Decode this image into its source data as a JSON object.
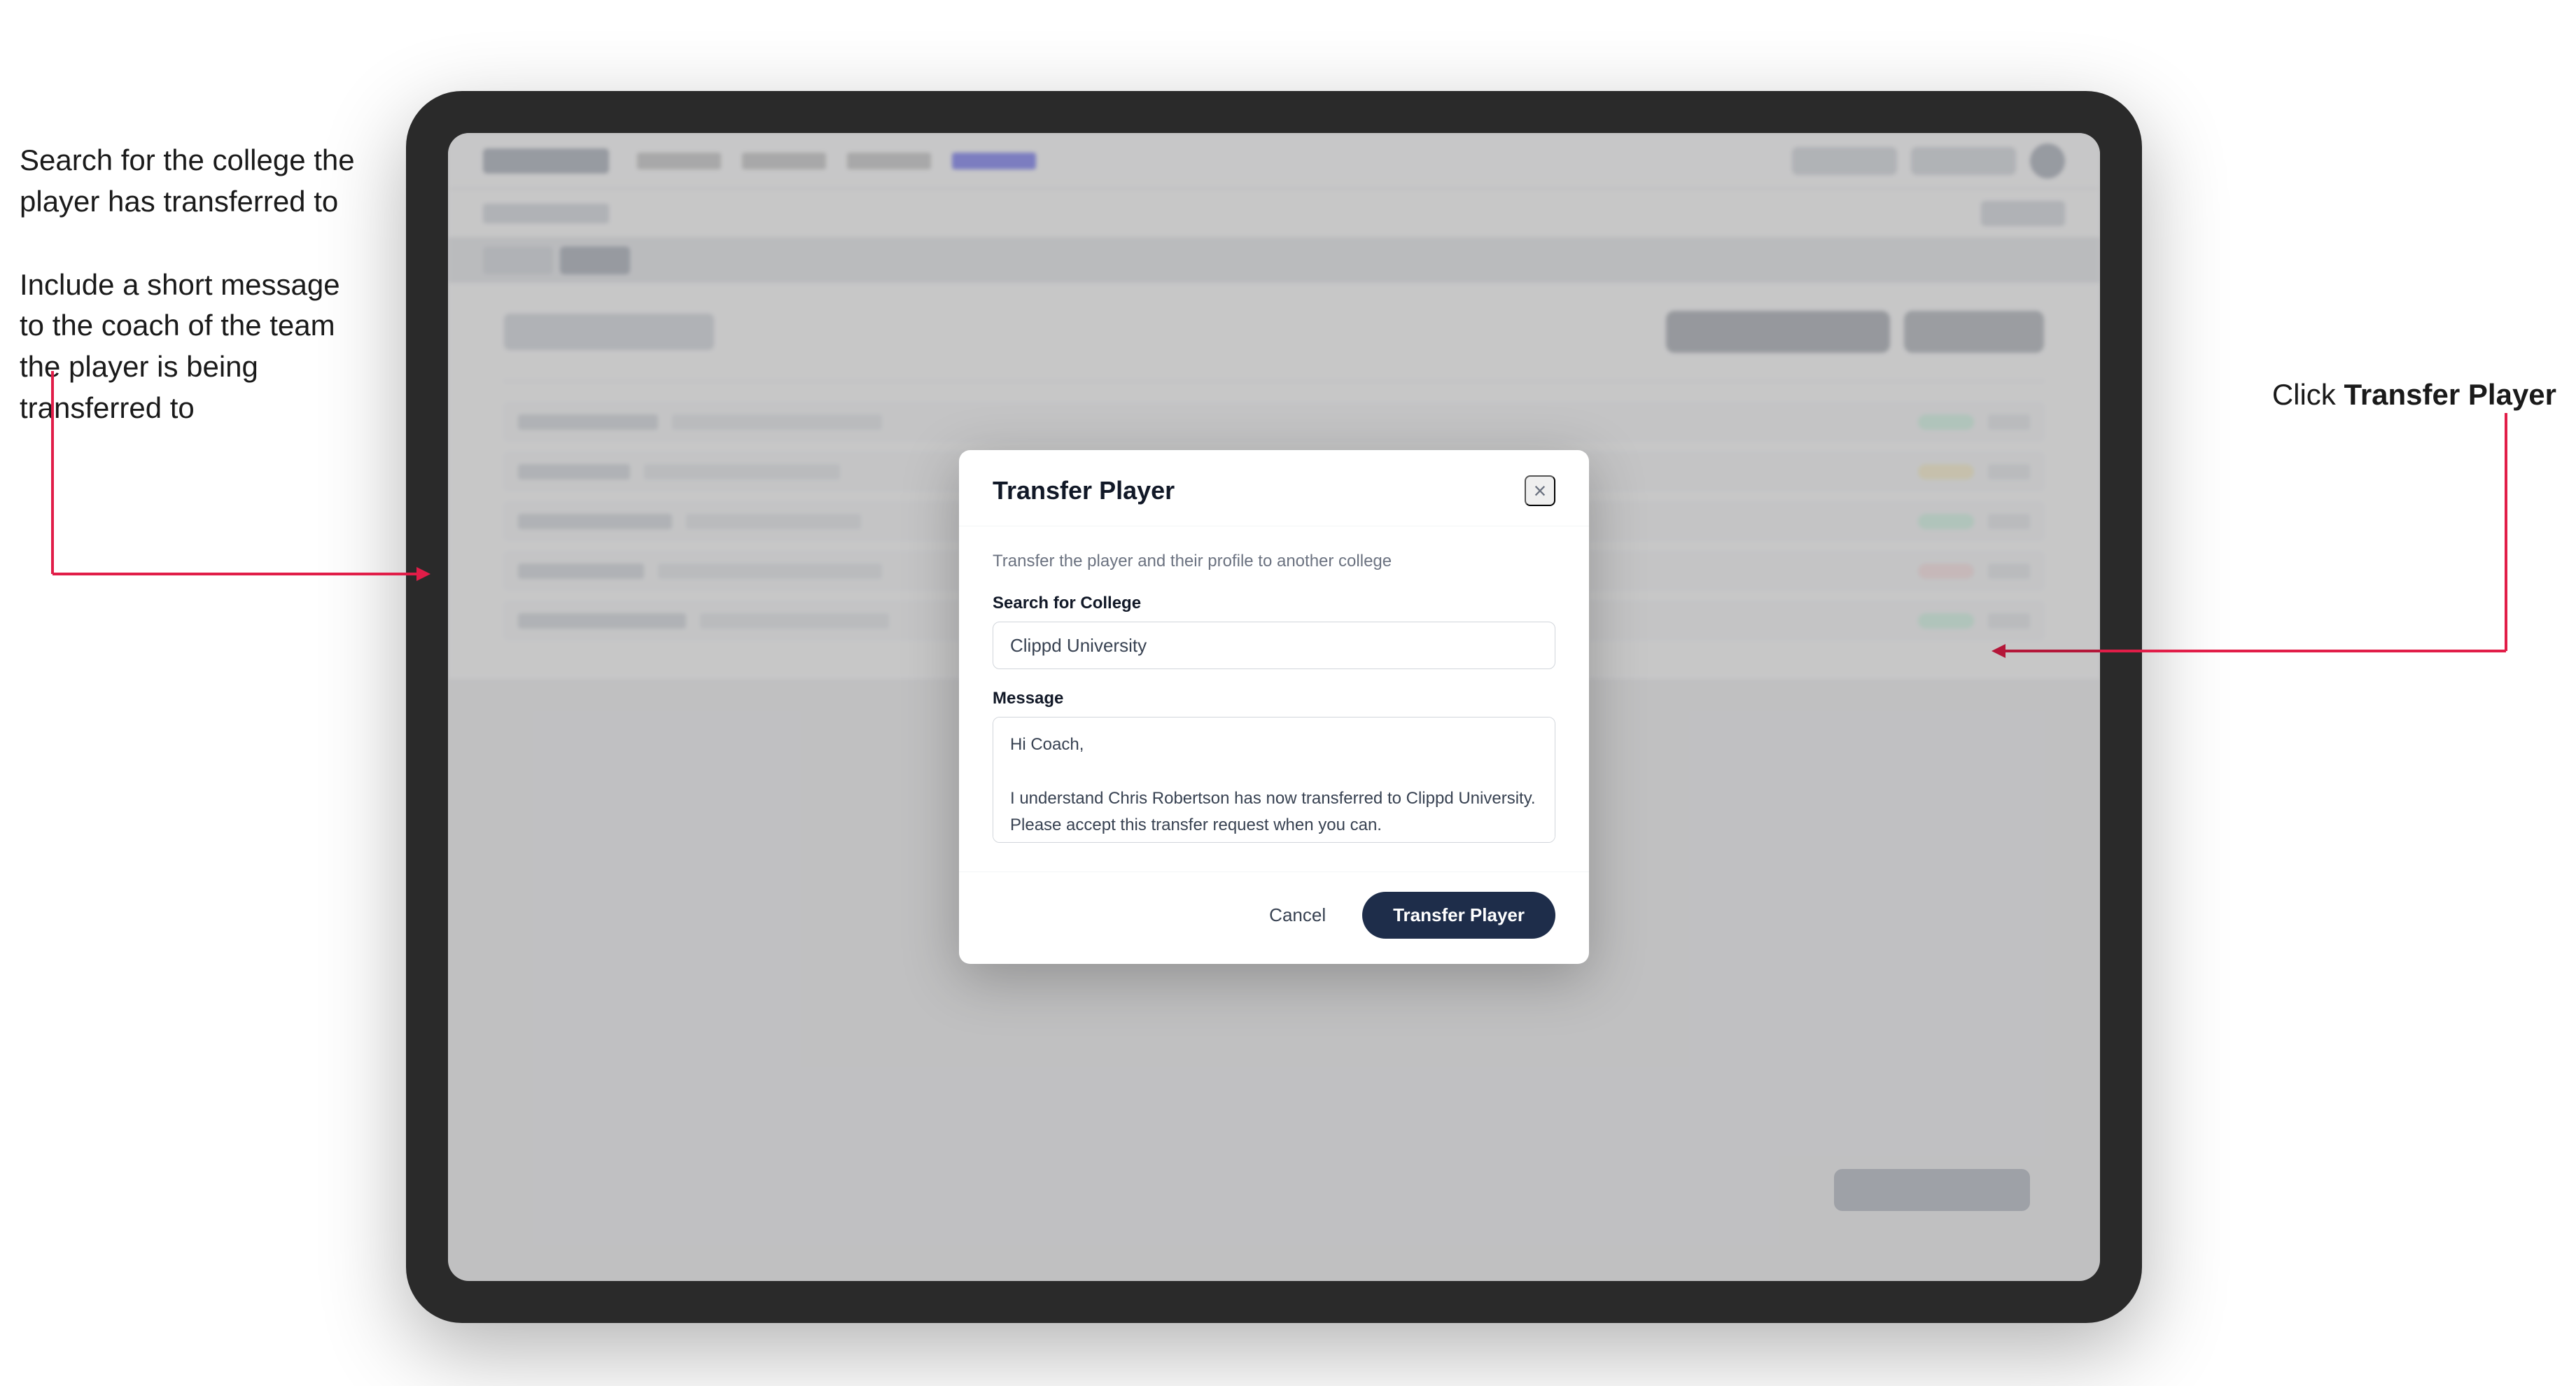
{
  "annotations": {
    "left_top": "Search for the college the player has transferred to",
    "left_bottom": "Include a short message to the coach of the team the player is being transferred to",
    "right": "Click ",
    "right_bold": "Transfer Player"
  },
  "modal": {
    "title": "Transfer Player",
    "subtitle": "Transfer the player and their profile to another college",
    "search_label": "Search for College",
    "search_value": "Clippd University",
    "search_placeholder": "Search for College",
    "message_label": "Message",
    "message_value": "Hi Coach,\n\nI understand Chris Robertson has now transferred to Clippd University. Please accept this transfer request when you can.",
    "cancel_label": "Cancel",
    "transfer_label": "Transfer Player",
    "close_icon": "×"
  },
  "app_bg": {
    "title": "Update Roster"
  }
}
